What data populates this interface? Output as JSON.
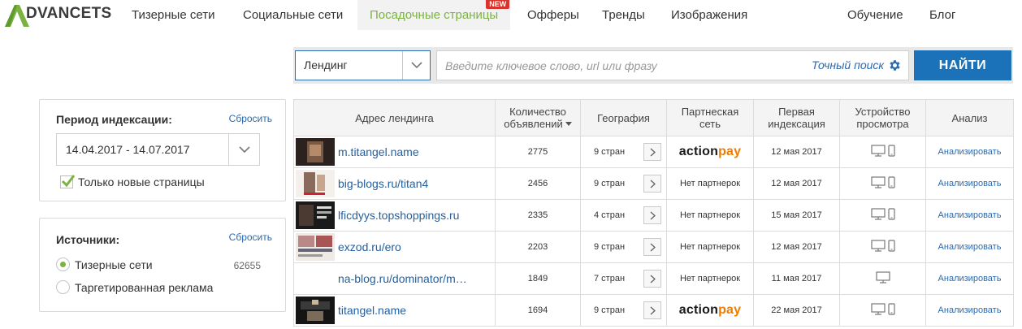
{
  "brand": {
    "logo_text": "DVANCETS"
  },
  "nav": {
    "items": [
      {
        "label": "Тизерные сети"
      },
      {
        "label": "Социальные сети"
      },
      {
        "label": "Посадочные страницы",
        "badge": "NEW"
      },
      {
        "label": "Офферы"
      },
      {
        "label": "Тренды"
      },
      {
        "label": "Изображения"
      },
      {
        "label": "Обучение"
      },
      {
        "label": "Блог"
      }
    ]
  },
  "search": {
    "type_selected": "Лендинг",
    "placeholder": "Введите ключевое слово, url или фразу",
    "exact_label": "Точный поиск",
    "submit_label": "НАЙТИ"
  },
  "period": {
    "title": "Период индексации:",
    "reset": "Сбросить",
    "range": "14.04.2017 - 14.07.2017",
    "only_new_label": "Только новые страницы",
    "only_new_checked": true
  },
  "sources": {
    "title": "Источники:",
    "reset": "Сбросить",
    "options": [
      {
        "label": "Тизерные сети",
        "count": "62655",
        "selected": true
      },
      {
        "label": "Таргетированная реклама",
        "count": "",
        "selected": false
      }
    ]
  },
  "table": {
    "headers": {
      "url": "Адрес лендинга",
      "count": "Количество объявлений",
      "geo": "География",
      "network": "Партнеская сеть",
      "first": "Первая индексация",
      "device": "Устройство просмотра",
      "analysis": "Анализ"
    },
    "analyze_label": "Анализировать",
    "actionpay": {
      "part1": "action",
      "part2": "pay"
    },
    "rows": [
      {
        "url": "m.titangel.name",
        "count": "2775",
        "geo": "9 стран",
        "network": "",
        "first": "12 мая 2017"
      },
      {
        "url": "big-blogs.ru/titan4",
        "count": "2456",
        "geo": "9 стран",
        "network": "Нет партнерок",
        "first": "12 мая 2017"
      },
      {
        "url": "lficdyys.topshoppings.ru",
        "count": "2335",
        "geo": "4 стран",
        "network": "Нет партнерок",
        "first": "15 мая 2017"
      },
      {
        "url": "exzod.ru/ero",
        "count": "2203",
        "geo": "9 стран",
        "network": "Нет партнерок",
        "first": "12 мая 2017"
      },
      {
        "url": "na-blog.ru/dominator/m…",
        "count": "1849",
        "geo": "7 стран",
        "network": "Нет партнерок",
        "first": "11 мая 2017"
      },
      {
        "url": "titangel.name",
        "count": "1694",
        "geo": "9 стран",
        "network": "",
        "first": "22 мая 2017"
      }
    ]
  },
  "colors": {
    "accent_green": "#7bb241",
    "primary_blue": "#1b72b8",
    "link_blue": "#245f9e",
    "badge_red": "#d9342b",
    "actionpay_orange": "#f07d00"
  }
}
